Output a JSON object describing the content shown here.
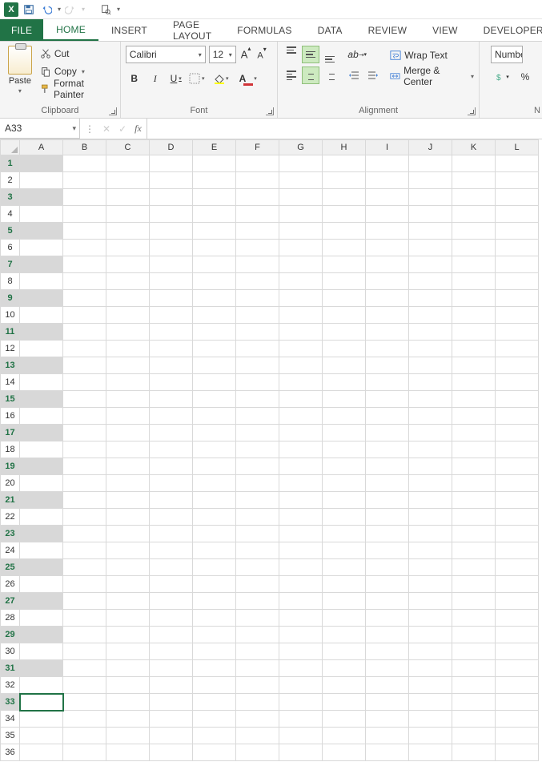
{
  "qat": {
    "app_name": "Excel",
    "save_tooltip": "Save",
    "undo_tooltip": "Undo",
    "redo_tooltip": "Redo",
    "preview_tooltip": "Print Preview"
  },
  "tabs": {
    "file": "FILE",
    "home": "HOME",
    "insert": "INSERT",
    "page_layout": "PAGE LAYOUT",
    "formulas": "FORMULAS",
    "data": "DATA",
    "review": "REVIEW",
    "view": "VIEW",
    "developer": "DEVELOPER"
  },
  "ribbon": {
    "clipboard": {
      "title": "Clipboard",
      "paste": "Paste",
      "cut": "Cut",
      "copy": "Copy",
      "format_painter": "Format Painter"
    },
    "font": {
      "title": "Font",
      "font_name": "Calibri",
      "font_size": "12",
      "bold": "B",
      "italic": "I",
      "underline": "U"
    },
    "alignment": {
      "title": "Alignment",
      "wrap_text": "Wrap Text",
      "merge_center": "Merge & Center"
    },
    "number": {
      "title": "N",
      "format": "Numbe",
      "percent": "%"
    }
  },
  "namebox": {
    "value": "A33"
  },
  "formula_bar": {
    "fx_label": "fx",
    "value": ""
  },
  "grid": {
    "columns": [
      "A",
      "B",
      "C",
      "D",
      "E",
      "F",
      "G",
      "H",
      "I",
      "J",
      "K",
      "L"
    ],
    "rows": [
      1,
      2,
      3,
      4,
      5,
      6,
      7,
      8,
      9,
      10,
      11,
      12,
      13,
      14,
      15,
      16,
      17,
      18,
      19,
      20,
      21,
      22,
      23,
      24,
      25,
      26,
      27,
      28,
      29,
      30,
      31,
      32,
      33,
      34,
      35,
      36
    ],
    "highlighted_rows": [
      1,
      3,
      5,
      7,
      9,
      11,
      13,
      15,
      17,
      19,
      21,
      23,
      25,
      27,
      29,
      31
    ],
    "active_cell_row": 33,
    "active_cell_col": "A"
  }
}
